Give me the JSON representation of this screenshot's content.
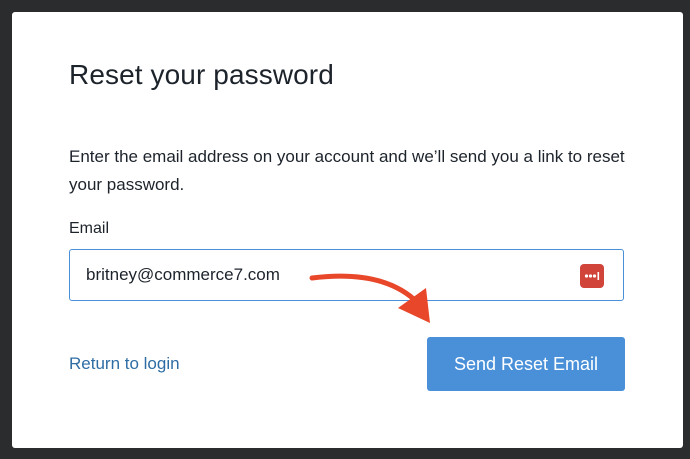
{
  "dialog": {
    "title": "Reset your password",
    "description": "Enter the email address on your account and we’ll send you a link to reset your password.",
    "email_label": "Email",
    "email_value": "britney@commerce7.com",
    "return_link": "Return to login",
    "send_button": "Send Reset Email"
  },
  "icons": {
    "password_manager": "password-manager-icon",
    "annotation": "red-arrow"
  },
  "colors": {
    "page_background": "#2b2c2e",
    "card_background": "#ffffff",
    "primary_button": "#4a90d9",
    "link": "#2e6da4",
    "input_border": "#4a90d9",
    "password_manager_icon": "#d0443a",
    "annotation_arrow": "#e8472a"
  }
}
